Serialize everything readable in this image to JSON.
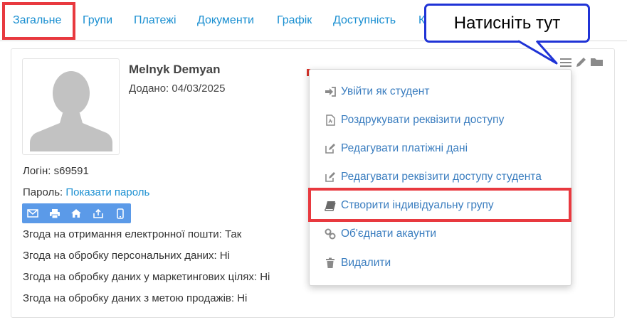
{
  "tabs": [
    {
      "label": "Загальне",
      "active": true
    },
    {
      "label": "Групи"
    },
    {
      "label": "Платежі"
    },
    {
      "label": "Документи"
    },
    {
      "label": "Графік"
    },
    {
      "label": "Доступність"
    },
    {
      "label": "К"
    }
  ],
  "student": {
    "name": "Melnyk Demyan",
    "added": "Додано: 04/03/2025",
    "login_label": "Логін: s69591",
    "password_label": "Пароль: ",
    "password_link": "Показати пароль"
  },
  "consents": [
    "Згода на отримання електронної пошти: Так",
    "Згода на обробку персональних даних: Ні",
    "Згода на обробку даних у маркетингових цілях: Ні",
    "Згода на обробку даних з метою продажів: Ні"
  ],
  "action_icons": [
    "envelope-icon",
    "print-icon",
    "home-icon",
    "share-icon",
    "mobile-icon"
  ],
  "top_icons": [
    "menu-icon",
    "pencil-icon",
    "folder-icon"
  ],
  "menu": [
    {
      "label": "Увійти як студент",
      "icon": "sign-in-icon"
    },
    {
      "label": "Роздрукувати реквізити доступу",
      "icon": "pdf-icon"
    },
    {
      "label": "Редагувати платіжні дані",
      "icon": "edit-icon"
    },
    {
      "label": "Редагувати реквізити доступу студента",
      "icon": "edit-icon"
    },
    {
      "label": "Створити індивідуальну групу",
      "icon": "book-icon",
      "highlighted": true
    },
    {
      "label": "Об'єднати акаунти",
      "icon": "link-icon"
    },
    {
      "label": "Видалити",
      "icon": "trash-icon"
    }
  ],
  "callout": {
    "text": "Натисніть тут"
  },
  "colors": {
    "link": "#1a8fd1",
    "menu_text": "#3a7dbf",
    "highlight": "#e8393f",
    "callout_border": "#1f33d6",
    "action_bar": "#5b9ae8"
  }
}
